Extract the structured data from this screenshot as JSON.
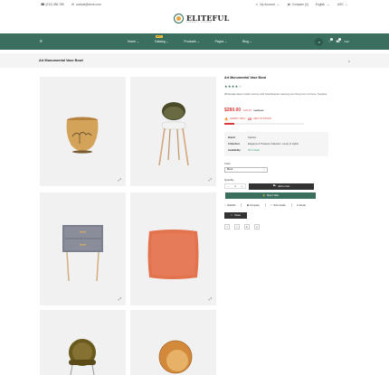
{
  "topbar": {
    "phone": "(012) 456-789",
    "email": "contact@store.com",
    "account": "My Account",
    "compare": "Compare (0)",
    "language": "English",
    "currency": "USD"
  },
  "brand": {
    "name": "ELITEFUL",
    "tagline": "LUXURY + LOUNGE"
  },
  "nav": {
    "items": [
      {
        "label": "Home"
      },
      {
        "label": "Catalog",
        "badge": "HOT"
      },
      {
        "label": "Products"
      },
      {
        "label": "Pages"
      },
      {
        "label": "Blog"
      }
    ],
    "wishlist_count": "0",
    "cart_count": "0",
    "cart_label": "Cart"
  },
  "breadcrumb": {
    "title": "Art Monumental Vase Bowl"
  },
  "product": {
    "title": "Art Monumental Vase Bowl",
    "rating": 4,
    "rating_max": 5,
    "description": "Wholesale latest modern armory with Scandinavian weaving your living room & home. Supplies",
    "price": "$280.00",
    "discount": "12% off",
    "old_price": "$385.00",
    "sold_prefix": "HURRY ONLY",
    "sold_count": "25",
    "sold_suffix": "LEFT IN STOCK",
    "stock_progress": 0.12,
    "meta": [
      {
        "key": "Brand:",
        "value": "Fashion"
      },
      {
        "key": "Collection:",
        "value": "Elegance & Timeless Collection, Luxury & stylish"
      },
      {
        "key": "Availability:",
        "value": "35 In Stock"
      }
    ],
    "color_label": "Color",
    "color_value": "Black",
    "quantity_label": "Quantity",
    "quantity_value": "1",
    "add_to_cart": "Add to Cart",
    "buy_now": "Buy It Now",
    "wishlist": "Wishlist",
    "compare": "Compare",
    "size_guide": "Size Guide",
    "email": "Email",
    "share": "Share",
    "socials": [
      "f",
      "t",
      "in",
      "p"
    ]
  },
  "gallery": {
    "zoom_icon": "zoom-icon"
  }
}
